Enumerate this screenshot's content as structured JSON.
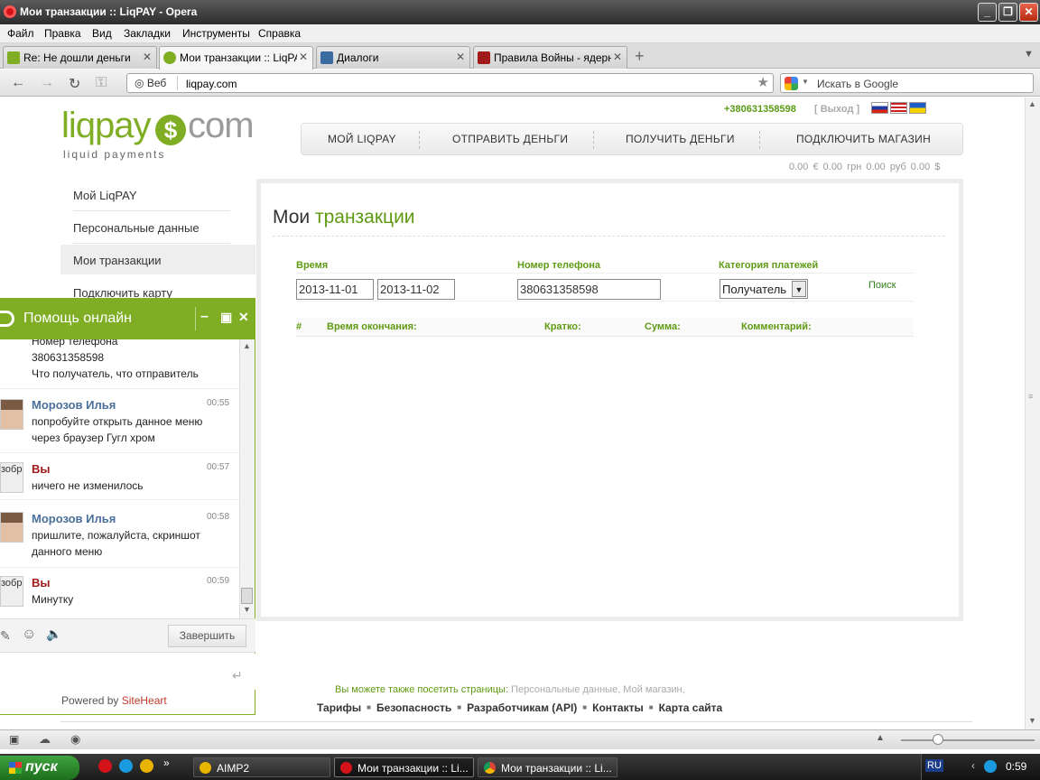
{
  "window": {
    "title": "Мои транзакции :: LiqPAY - Opera"
  },
  "menu": [
    "Файл",
    "Правка",
    "Вид",
    "Закладки",
    "Инструменты",
    "Справка"
  ],
  "tabs": [
    {
      "label": "Re: Не дошли деньги",
      "icon_color": "#7fae24"
    },
    {
      "label": "Мои транзакции :: LiqPAY",
      "icon_color": "#7fae24"
    },
    {
      "label": "Диалоги",
      "icon_color": "#3b6aa0"
    },
    {
      "label": "Правила Войны - ядерн...",
      "icon_color": "#a01a1a"
    }
  ],
  "address": {
    "web_label": "Веб",
    "url": "liqpay.com"
  },
  "search": {
    "placeholder": "Искать в Google"
  },
  "header": {
    "logo_left": "liqpay",
    "logo_coin": "$",
    "logo_right": "com",
    "logo_sub": "liquid payments",
    "phone": "+380631358598",
    "logout": "[ Выход ]",
    "nav": [
      "МОЙ LIQPAY",
      "ОТПРАВИТЬ ДЕНЬГИ",
      "ПОЛУЧИТЬ ДЕНЬГИ",
      "ПОДКЛЮЧИТЬ МАГАЗИН"
    ],
    "balance": "0.00 €   0.00 грн   0.00 руб   0.00 $"
  },
  "sidebar": [
    "Мой LiqPAY",
    "Персональные данные",
    "Мои транзакции",
    "Подключить карту"
  ],
  "content": {
    "title_a": "Мои",
    "title_b": "транзакции",
    "filters": {
      "time_label": "Время",
      "date_from": "2013-11-01",
      "date_to": "2013-11-02",
      "phone_label": "Номер телефона",
      "phone_value": "380631358598",
      "category_label": "Категория платежей",
      "category_value": "Получатель",
      "search_link": "Поиск"
    },
    "columns": [
      "#",
      "Время окончания:",
      "Кратко:",
      "Сумма:",
      "Комментарий:"
    ]
  },
  "footer": {
    "also": "Вы можете также посетить страницы:",
    "links_gray": "Персональные данные, Мой магазин,",
    "links": [
      "Тарифы",
      "Безопасность",
      "Разработчикам (API)",
      "Контакты",
      "Карта сайта"
    ]
  },
  "chat": {
    "title": "Помощь онлайн",
    "messages": [
      {
        "author": "",
        "time": "",
        "lines": [
          "Номер телефона",
          "380631358598",
          "Что получатель, что отправитель"
        ]
      },
      {
        "author": "Морозов Илья",
        "time": "00:55",
        "lines": [
          "попробуйте открыть данное меню",
          "через браузер Гугл хром"
        ]
      },
      {
        "author": "Вы",
        "time": "00:57",
        "lines": [
          "ничего не изменилось"
        ]
      },
      {
        "author": "Морозов Илья",
        "time": "00:58",
        "lines": [
          "пришлите, пожалуйста, скриншот",
          "данного меню"
        ]
      },
      {
        "author": "Вы",
        "time": "00:59",
        "lines": [
          "Минутку"
        ]
      }
    ],
    "end_button": "Завершить",
    "powered_prefix": "Powered by ",
    "powered_site": "SiteHeart",
    "avatar_you_text": "зобр"
  },
  "taskbar": {
    "start": "пуск",
    "items": [
      "AIMP2",
      "Мои транзакции :: Li...",
      "Мои транзакции :: Li..."
    ],
    "lang": "RU",
    "clock": "0:59"
  }
}
